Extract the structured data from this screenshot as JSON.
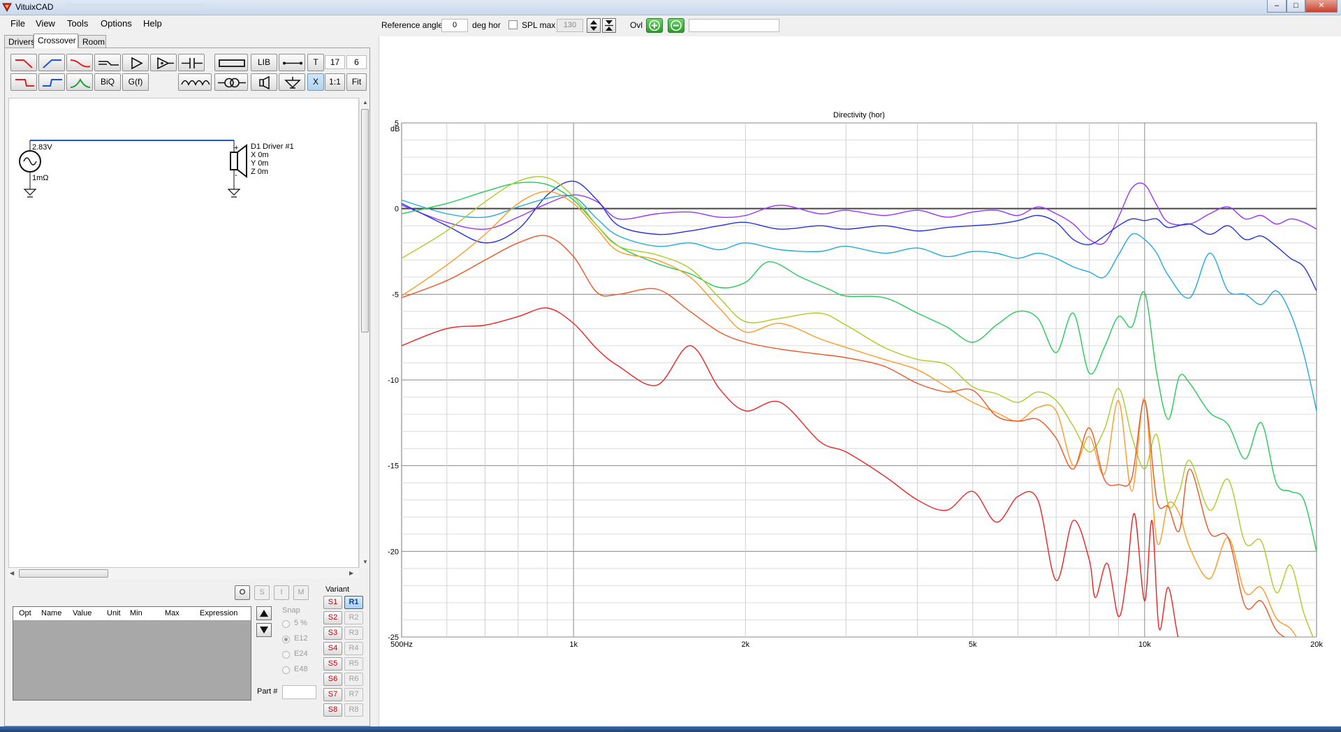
{
  "window": {
    "title": "VituixCAD",
    "min_label": "–",
    "max_label": "□",
    "close_label": "✕"
  },
  "menu": [
    "File",
    "View",
    "Tools",
    "Options",
    "Help"
  ],
  "tabs": [
    "Drivers",
    "Crossover",
    "Room"
  ],
  "toolbar": {
    "biq_label": "BiQ",
    "gf_label": "G(f)",
    "lib_label": "LIB",
    "t_label": "T",
    "x_label": "X",
    "one_to_one_label": "1:1",
    "fit_label": "Fit",
    "num1": "17",
    "num2": "6"
  },
  "schematic": {
    "source_voltage": "2.83V",
    "source_impedance": "1mΩ",
    "driver_name": "D1 Driver #1",
    "driver_x": "X 0m",
    "driver_y": "Y 0m",
    "driver_z": "Z 0m",
    "plus": "+",
    "minus": "-"
  },
  "part_controls": {
    "o": "O",
    "s": "S",
    "i": "I",
    "m": "M"
  },
  "part_table": {
    "columns": [
      "Opt",
      "Name",
      "Value",
      "Unit",
      "Min",
      "Max",
      "Expression"
    ]
  },
  "snap": {
    "label": "Snap",
    "options": [
      "5 %",
      "E12",
      "E24",
      "E48"
    ],
    "selected": "E12"
  },
  "part_number_label": "Part #",
  "variant": {
    "label": "Variant",
    "s_buttons": [
      "S1",
      "S2",
      "S3",
      "S4",
      "S5",
      "S6",
      "S7",
      "S8"
    ],
    "r_buttons": [
      "R1",
      "R2",
      "R3",
      "R4",
      "R5",
      "R6",
      "R7",
      "R8"
    ],
    "active_r": "R1"
  },
  "top_controls": {
    "reference_angle_label": "Reference angle",
    "reference_angle_value": "0",
    "deg_hor_label": "deg hor",
    "spl_max_label": "SPL max",
    "spl_max_value": "130",
    "ovl_label": "Ovl"
  },
  "chart_data": {
    "type": "line",
    "title": "Directivity (hor)",
    "ylabel": "dB",
    "xscale": "log",
    "xlim": [
      500,
      20000
    ],
    "ylim": [
      -25,
      5
    ],
    "xticks": [
      {
        "value": 500,
        "label": "500Hz"
      },
      {
        "value": 1000,
        "label": "1k"
      },
      {
        "value": 2000,
        "label": "2k"
      },
      {
        "value": 5000,
        "label": "5k"
      },
      {
        "value": 10000,
        "label": "10k"
      },
      {
        "value": 20000,
        "label": "20k"
      }
    ],
    "yticks": [
      5,
      0,
      -5,
      -10,
      -15,
      -20,
      -25
    ],
    "grid": true,
    "series": [
      {
        "color": "#9933ff",
        "x": [
          500,
          600,
          700,
          800,
          900,
          1000,
          1100,
          1200,
          1400,
          1600,
          1800,
          2000,
          2300,
          2700,
          3000,
          3500,
          4000,
          4500,
          5000,
          5500,
          6000,
          6500,
          7000,
          7500,
          8000,
          8500,
          9000,
          9500,
          10000,
          10500,
          11000,
          12000,
          13000,
          14000,
          15000,
          16000,
          17000,
          18000,
          19000,
          20000
        ],
        "y": [
          0.2,
          -0.8,
          -1.2,
          -0.5,
          0.3,
          0.8,
          0.4,
          -0.6,
          -0.3,
          -0.2,
          -0.5,
          -0.4,
          0.2,
          -0.3,
          -0.1,
          -0.4,
          -0.1,
          -0.5,
          -0.2,
          -0.1,
          -0.4,
          0.1,
          -0.3,
          -0.9,
          -1.8,
          -2.0,
          -0.5,
          1.2,
          1.4,
          0.2,
          -0.8,
          -0.9,
          -0.3,
          0.1,
          -0.6,
          -0.4,
          -0.9,
          -0.6,
          -0.8,
          -1.2
        ]
      },
      {
        "color": "#2233dd",
        "x": [
          500,
          600,
          700,
          800,
          900,
          1000,
          1100,
          1200,
          1400,
          1600,
          1800,
          2000,
          2300,
          2700,
          3000,
          3500,
          4000,
          4500,
          5000,
          5500,
          6000,
          6500,
          7000,
          7500,
          8000,
          8500,
          9000,
          9500,
          10000,
          10500,
          11000,
          12000,
          13000,
          14000,
          15000,
          16000,
          17000,
          18000,
          19000,
          20000
        ],
        "y": [
          0.3,
          -1.0,
          -2.0,
          -1.2,
          0.8,
          1.6,
          0.5,
          -1.0,
          -1.5,
          -1.3,
          -1.0,
          -0.8,
          -1.2,
          -1.0,
          -1.2,
          -1.0,
          -1.3,
          -1.1,
          -1.0,
          -0.9,
          -0.7,
          -0.4,
          -0.8,
          -1.8,
          -2.1,
          -1.6,
          -1.0,
          -0.6,
          -0.7,
          -0.6,
          -1.1,
          -0.9,
          -1.5,
          -1.0,
          -1.8,
          -1.6,
          -2.2,
          -2.9,
          -3.4,
          -4.8
        ]
      },
      {
        "color": "#22aadd",
        "x": [
          500,
          600,
          700,
          800,
          900,
          1000,
          1100,
          1200,
          1400,
          1600,
          1800,
          2000,
          2300,
          2700,
          3000,
          3500,
          4000,
          4500,
          5000,
          5500,
          6000,
          6500,
          7000,
          7500,
          8000,
          8500,
          9000,
          9500,
          10000,
          10500,
          11000,
          12000,
          13000,
          14000,
          15000,
          16000,
          17000,
          18000,
          19000,
          20000
        ],
        "y": [
          0.5,
          -0.3,
          -0.5,
          0.1,
          0.6,
          0.7,
          -0.6,
          -1.6,
          -2.2,
          -2.0,
          -2.4,
          -2.0,
          -2.4,
          -2.5,
          -2.2,
          -2.6,
          -2.3,
          -2.8,
          -2.5,
          -2.6,
          -2.9,
          -2.6,
          -2.9,
          -3.4,
          -3.7,
          -4.0,
          -2.7,
          -1.5,
          -1.8,
          -2.6,
          -3.9,
          -5.2,
          -2.6,
          -4.8,
          -5.0,
          -5.6,
          -4.8,
          -6.1,
          -8.5,
          -11.8
        ]
      },
      {
        "color": "#22cc55",
        "x": [
          500,
          600,
          700,
          800,
          900,
          1000,
          1100,
          1200,
          1400,
          1600,
          1800,
          2000,
          2200,
          2500,
          2800,
          3000,
          3500,
          4000,
          4500,
          5000,
          5500,
          6000,
          6500,
          7000,
          7500,
          8000,
          8500,
          9000,
          9500,
          10000,
          10500,
          11000,
          11500,
          12000,
          13000,
          14000,
          15000,
          16000,
          17000,
          18000,
          19000,
          20000
        ],
        "y": [
          -0.3,
          0.3,
          1.0,
          1.5,
          1.4,
          0.5,
          -1.0,
          -2.2,
          -3.2,
          -3.8,
          -4.6,
          -4.3,
          -3.1,
          -4.0,
          -4.7,
          -5.1,
          -5.2,
          -6.1,
          -6.9,
          -7.8,
          -6.8,
          -6.0,
          -6.4,
          -8.4,
          -6.1,
          -9.6,
          -8.1,
          -6.3,
          -6.9,
          -4.9,
          -9.6,
          -12.3,
          -9.8,
          -10.2,
          -11.9,
          -12.6,
          -14.6,
          -12.5,
          -16.0,
          -16.5,
          -17.0,
          -20.0
        ]
      },
      {
        "color": "#aacc22",
        "x": [
          500,
          600,
          700,
          800,
          900,
          1000,
          1100,
          1200,
          1400,
          1600,
          1800,
          2000,
          2300,
          2700,
          3000,
          3500,
          4000,
          4500,
          5000,
          5500,
          6000,
          6500,
          7000,
          7500,
          8000,
          8500,
          9000,
          9500,
          10000,
          10500,
          11000,
          11500,
          12000,
          13000,
          14000,
          15000,
          16000,
          17000,
          18000,
          19000,
          20000
        ],
        "y": [
          -2.9,
          -1.3,
          0.4,
          1.6,
          1.8,
          0.7,
          -1.0,
          -2.2,
          -2.7,
          -3.5,
          -5.2,
          -6.6,
          -6.4,
          -6.1,
          -6.8,
          -8.1,
          -8.8,
          -9.1,
          -10.4,
          -10.8,
          -11.3,
          -10.7,
          -11.2,
          -12.7,
          -14.2,
          -12.9,
          -10.5,
          -13.3,
          -15.2,
          -13.2,
          -17.3,
          -16.5,
          -14.7,
          -17.6,
          -15.8,
          -19.5,
          -19.4,
          -22.4,
          -20.8,
          -23.6,
          -25.5
        ]
      },
      {
        "color": "#ff9922",
        "x": [
          500,
          600,
          700,
          800,
          900,
          1000,
          1100,
          1200,
          1400,
          1600,
          1800,
          2000,
          2300,
          2700,
          3000,
          3500,
          4000,
          4500,
          5000,
          5500,
          6000,
          6500,
          7000,
          7500,
          8000,
          8500,
          9000,
          9500,
          10000,
          10500,
          11000,
          11500,
          12000,
          13000,
          14000,
          15000,
          16000,
          17000,
          18000,
          19000,
          20000
        ],
        "y": [
          -5.1,
          -3.3,
          -1.5,
          0.3,
          1.0,
          0.3,
          -1.2,
          -2.5,
          -3.0,
          -4.0,
          -5.8,
          -7.2,
          -6.7,
          -7.6,
          -8.1,
          -8.8,
          -9.4,
          -10.4,
          -11.3,
          -11.9,
          -12.4,
          -11.6,
          -11.8,
          -15.0,
          -13.3,
          -15.5,
          -11.2,
          -16.5,
          -11.1,
          -19.4,
          -17.2,
          -17.8,
          -19.8,
          -21.6,
          -19.2,
          -22.4,
          -22.1,
          -23.9,
          -24.5,
          -25.6,
          -26.0
        ]
      },
      {
        "color": "#ee5522",
        "x": [
          500,
          600,
          700,
          800,
          900,
          1000,
          1100,
          1200,
          1400,
          1600,
          1800,
          2000,
          2300,
          2700,
          3000,
          3500,
          4000,
          4500,
          5000,
          5500,
          6000,
          6500,
          7000,
          7500,
          8000,
          8500,
          9000,
          9500,
          10000,
          10500,
          11000,
          11500,
          12000,
          13000,
          14000,
          15000,
          16000,
          17000,
          18000,
          19000,
          20000
        ],
        "y": [
          -5.2,
          -4.2,
          -3.0,
          -2.0,
          -1.6,
          -2.8,
          -4.9,
          -5.0,
          -4.7,
          -6.0,
          -7.2,
          -7.8,
          -8.2,
          -8.5,
          -8.7,
          -9.2,
          -10.2,
          -10.7,
          -10.6,
          -12.1,
          -12.4,
          -12.3,
          -13.4,
          -15.2,
          -12.8,
          -15.8,
          -16.1,
          -15.7,
          -11.2,
          -17.0,
          -17.4,
          -18.8,
          -15.2,
          -18.9,
          -19.2,
          -23.2,
          -22.9,
          -24.6,
          -25.2,
          -25.9,
          -26.2
        ]
      },
      {
        "color": "#ee2222",
        "x": [
          500,
          600,
          700,
          800,
          900,
          1000,
          1100,
          1200,
          1400,
          1600,
          1800,
          2000,
          2300,
          2700,
          3000,
          3500,
          4000,
          4500,
          5000,
          5500,
          6000,
          6500,
          7000,
          7500,
          8000,
          8200,
          8600,
          9000,
          9300,
          9600,
          10000,
          10300,
          10600,
          11000,
          11500,
          12000,
          13000,
          14000,
          15000,
          16000,
          17000,
          18000,
          19000,
          20000
        ],
        "y": [
          -8.0,
          -7.0,
          -6.8,
          -6.3,
          -5.8,
          -6.7,
          -8.2,
          -9.2,
          -10.3,
          -8.0,
          -10.5,
          -11.8,
          -11.3,
          -13.6,
          -14.2,
          -15.6,
          -17.0,
          -17.6,
          -16.5,
          -18.3,
          -16.8,
          -17.0,
          -21.7,
          -18.2,
          -20.5,
          -22.7,
          -20.7,
          -23.8,
          -21.5,
          -17.8,
          -22.9,
          -18.2,
          -24.5,
          -22.1,
          -25.3,
          -25.7,
          -25.9,
          -26.0,
          -26.1,
          -26.2,
          -26.3,
          -26.4,
          -26.5,
          -26.6
        ]
      }
    ]
  }
}
